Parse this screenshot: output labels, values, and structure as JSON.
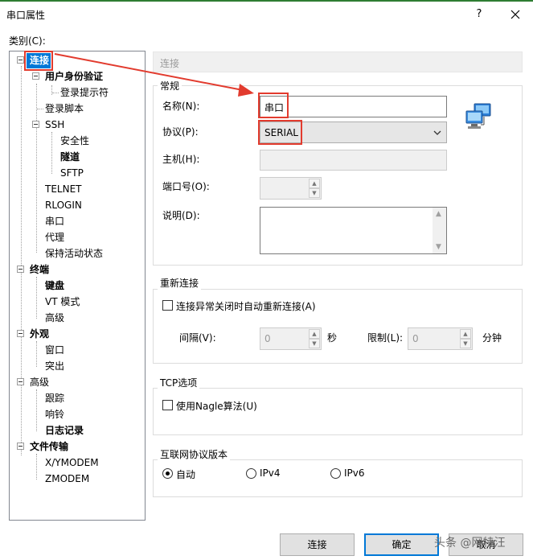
{
  "window": {
    "title": "串口属性",
    "help": "?"
  },
  "category_label": "类别(C):",
  "tree": {
    "items": [
      {
        "label": "连接",
        "bold": true,
        "selected": true
      },
      {
        "label": "用户身份验证",
        "bold": true
      },
      {
        "label": "登录提示符"
      },
      {
        "label": "登录脚本"
      },
      {
        "label": "SSH"
      },
      {
        "label": "安全性"
      },
      {
        "label": "隧道",
        "bold": true
      },
      {
        "label": "SFTP"
      },
      {
        "label": "TELNET"
      },
      {
        "label": "RLOGIN"
      },
      {
        "label": "串口"
      },
      {
        "label": "代理"
      },
      {
        "label": "保持活动状态"
      },
      {
        "label": "终端",
        "bold": true
      },
      {
        "label": "键盘",
        "bold": true
      },
      {
        "label": "VT 模式"
      },
      {
        "label": "高级"
      },
      {
        "label": "外观",
        "bold": true
      },
      {
        "label": "窗口"
      },
      {
        "label": "突出"
      },
      {
        "label": "高级"
      },
      {
        "label": "跟踪"
      },
      {
        "label": "响铃"
      },
      {
        "label": "日志记录",
        "bold": true
      },
      {
        "label": "文件传输",
        "bold": true
      },
      {
        "label": "X/YMODEM"
      },
      {
        "label": "ZMODEM"
      }
    ]
  },
  "panel": {
    "header": "连接",
    "general": {
      "label": "常规",
      "name_label": "名称(N):",
      "name_value": "串口",
      "protocol_label": "协议(P):",
      "protocol_value": "SERIAL",
      "host_label": "主机(H):",
      "host_value": "",
      "port_label": "端口号(O):",
      "port_value": "",
      "desc_label": "说明(D):",
      "desc_value": ""
    },
    "reconnect": {
      "label": "重新连接",
      "auto_label": "连接异常关闭时自动重新连接(A)",
      "auto_checked": false,
      "interval_label": "间隔(V):",
      "interval_value": "0",
      "interval_unit": "秒",
      "limit_label": "限制(L):",
      "limit_value": "0",
      "limit_unit": "分钟"
    },
    "tcp": {
      "label": "TCP选项",
      "nagle_label": "使用Nagle算法(U)",
      "nagle_checked": false
    },
    "ipver": {
      "label": "互联网协议版本",
      "options": [
        "自动",
        "IPv4",
        "IPv6"
      ],
      "selected": "自动"
    }
  },
  "buttons": {
    "connect": "连接",
    "ok": "确定",
    "cancel": "取消"
  },
  "watermark": "头条 @网特汪",
  "colors": {
    "accent": "#0078d7",
    "annotation": "#e23b2e",
    "title_stripe": "#2e7d32"
  }
}
